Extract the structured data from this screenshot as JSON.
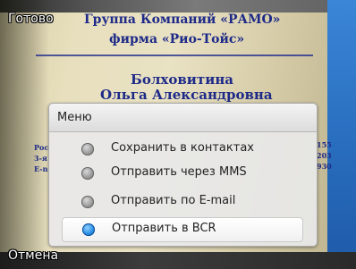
{
  "softkeys": {
    "top": "Готово",
    "bottom": "Отмена"
  },
  "card": {
    "line1": "Группа Компаний «РАМО»",
    "line2": "фирма «Рио-Тойс»",
    "line3": "Болховитина",
    "line4": "Ольга Александровна",
    "left_fragments": [
      "Рос",
      "3-я",
      "E-n"
    ],
    "right_fragments": [
      "155",
      "203",
      "930"
    ]
  },
  "menu": {
    "title": "Меню",
    "items": [
      {
        "label": "Сохранить в контактах",
        "icon": "radio-off-icon",
        "selected": false
      },
      {
        "label": "Отправить через MMS",
        "icon": "radio-off-icon",
        "selected": false
      },
      {
        "label": "Отправить по E-mail",
        "icon": "radio-off-icon",
        "selected": false
      },
      {
        "label": "Отправить в BCR",
        "icon": "radio-on-icon",
        "selected": true
      }
    ]
  },
  "colors": {
    "accent": "#2b8ee6",
    "card_text": "#1e2a88",
    "right_edge": "#2a6fc0"
  }
}
